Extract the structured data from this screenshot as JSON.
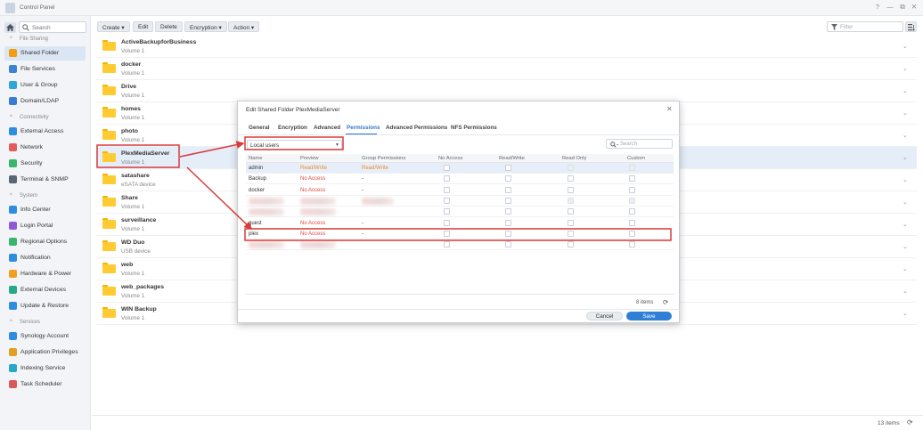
{
  "window": {
    "title": "Control Panel",
    "controls": [
      "?",
      "—",
      "⧉",
      "✕"
    ]
  },
  "sidebar": {
    "search_placeholder": "Search",
    "sections": [
      {
        "label": "File Sharing",
        "items": [
          {
            "label": "Shared Folder",
            "icon": "shared-folder-icon",
            "color": "#f39c12",
            "active": true
          },
          {
            "label": "File Services",
            "icon": "file-services-icon",
            "color": "#3b82d6"
          },
          {
            "label": "User & Group",
            "icon": "user-group-icon",
            "color": "#2fa6d9"
          },
          {
            "label": "Domain/LDAP",
            "icon": "domain-icon",
            "color": "#3b7bd8"
          }
        ]
      },
      {
        "label": "Connectivity",
        "items": [
          {
            "label": "External Access",
            "icon": "external-access-icon",
            "color": "#2d8ee0"
          },
          {
            "label": "Network",
            "icon": "network-icon",
            "color": "#e45c5c"
          },
          {
            "label": "Security",
            "icon": "security-icon",
            "color": "#3ab56a"
          },
          {
            "label": "Terminal & SNMP",
            "icon": "terminal-icon",
            "color": "#5a6673"
          }
        ]
      },
      {
        "label": "System",
        "items": [
          {
            "label": "Info Center",
            "icon": "info-icon",
            "color": "#2d8ee0"
          },
          {
            "label": "Login Portal",
            "icon": "login-portal-icon",
            "color": "#8e5bd6"
          },
          {
            "label": "Regional Options",
            "icon": "regional-icon",
            "color": "#3ab56a"
          },
          {
            "label": "Notification",
            "icon": "notification-icon",
            "color": "#2d8ee0"
          },
          {
            "label": "Hardware & Power",
            "icon": "hardware-icon",
            "color": "#f0a020"
          },
          {
            "label": "External Devices",
            "icon": "external-devices-icon",
            "color": "#27a887"
          },
          {
            "label": "Update & Restore",
            "icon": "update-icon",
            "color": "#2d8ee0"
          }
        ]
      },
      {
        "label": "Services",
        "items": [
          {
            "label": "Synology Account",
            "icon": "account-icon",
            "color": "#2d8ee0"
          },
          {
            "label": "Application Privileges",
            "icon": "privileges-icon",
            "color": "#e0a020"
          },
          {
            "label": "Indexing Service",
            "icon": "indexing-icon",
            "color": "#27a8c7"
          },
          {
            "label": "Task Scheduler",
            "icon": "scheduler-icon",
            "color": "#d85a5a"
          }
        ]
      }
    ]
  },
  "toolbar": {
    "create": "Create ▾",
    "edit": "Edit",
    "delete": "Delete",
    "encryption": "Encryption ▾",
    "action": "Action ▾",
    "filter_placeholder": "Filter"
  },
  "folders": [
    {
      "name": "ActiveBackupforBusiness",
      "location": "Volume 1"
    },
    {
      "name": "docker",
      "location": "Volume 1"
    },
    {
      "name": "Drive",
      "location": "Volume 1"
    },
    {
      "name": "homes",
      "location": "Volume 1"
    },
    {
      "name": "photo",
      "location": "Volume 1"
    },
    {
      "name": "PlexMediaServer",
      "location": "Volume 1",
      "selected": true
    },
    {
      "name": "satashare",
      "location": "eSATA device"
    },
    {
      "name": "Share",
      "location": "Volume 1"
    },
    {
      "name": "surveillance",
      "location": "Volume 1"
    },
    {
      "name": "WD Duo",
      "location": "USB device"
    },
    {
      "name": "web",
      "location": "Volume 1"
    },
    {
      "name": "web_packages",
      "location": "Volume 1"
    },
    {
      "name": "WIN Backup",
      "location": "Volume 1"
    }
  ],
  "statusbar": {
    "count": "13 items"
  },
  "dialog": {
    "title": "Edit Shared Folder PlexMediaServer",
    "tabs": [
      "General",
      "Encryption",
      "Advanced",
      "Permissions",
      "Advanced Permissions",
      "NFS Permissions"
    ],
    "active_tab": "Permissions",
    "user_type": "Local users",
    "search_placeholder": "Search",
    "columns": [
      "Name",
      "Preview",
      "Group Permissions",
      "No Access",
      "Read/Write",
      "Read Only",
      "Custom"
    ],
    "rows": [
      {
        "name": "admin",
        "preview": "Read/Write",
        "group": "Read/Write",
        "selected": true
      },
      {
        "name": "Backup",
        "preview": "No Access",
        "group": "-"
      },
      {
        "name": "docker",
        "preview": "No Access",
        "group": "-"
      },
      {
        "name": "",
        "preview": "",
        "group": "",
        "blurred": true
      },
      {
        "name": "",
        "preview": "",
        "group": "",
        "blurred": true
      },
      {
        "name": "guest",
        "preview": "No Access",
        "group": "-"
      },
      {
        "name": "plex",
        "preview": "No Access",
        "group": "-"
      },
      {
        "name": "",
        "preview": "",
        "group": "",
        "blurred": true
      }
    ],
    "count": "8 items",
    "cancel": "Cancel",
    "save": "Save"
  },
  "colors": {
    "accent": "#2f79c7",
    "annotation": "#d93b3b",
    "no_access": "#e0483c",
    "read_write": "#ea8c2a"
  }
}
